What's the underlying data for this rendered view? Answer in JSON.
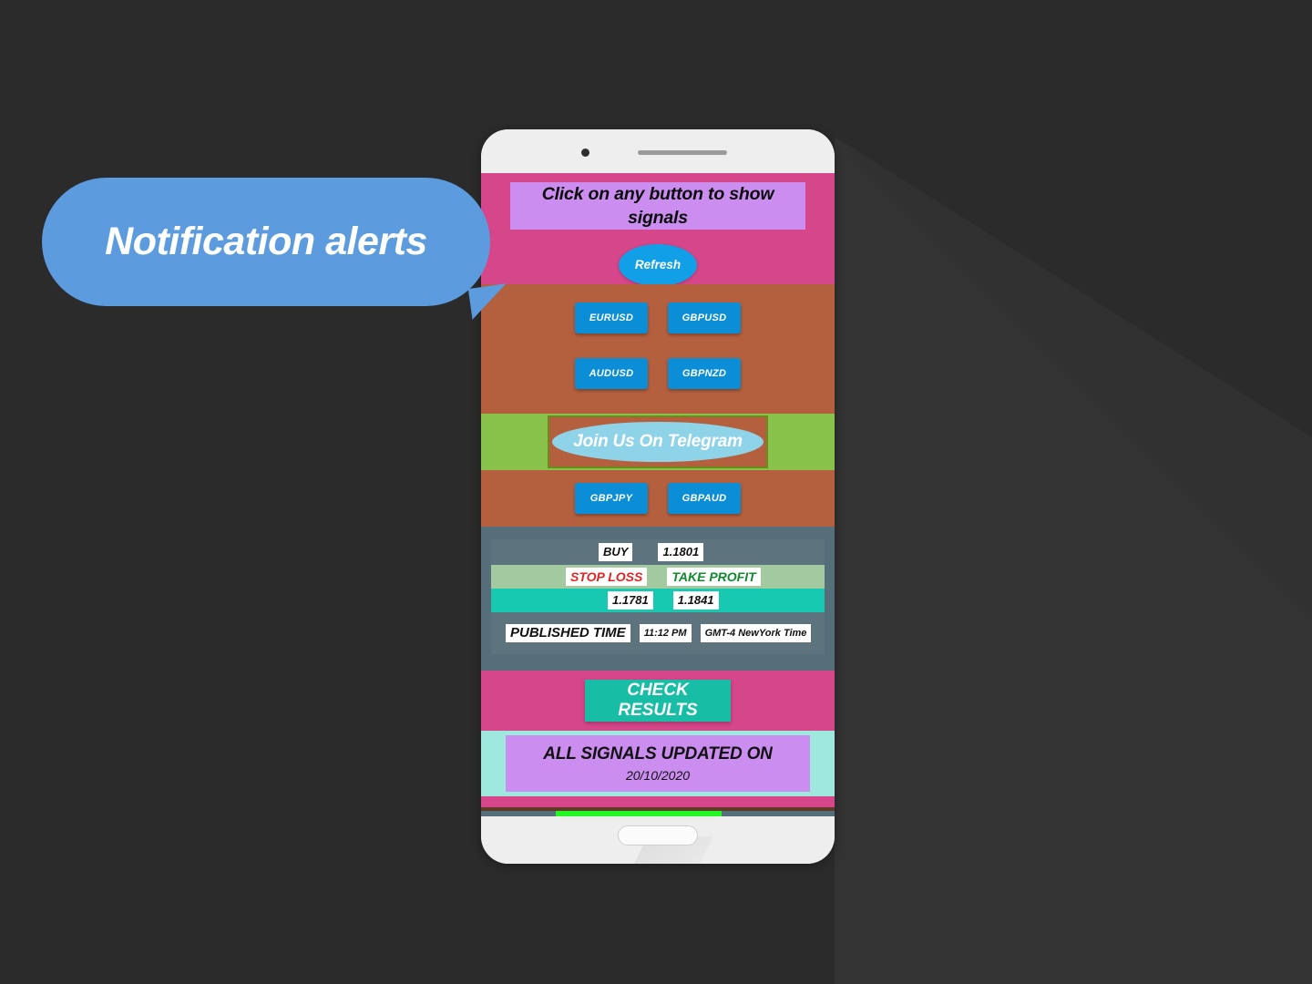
{
  "callout": {
    "text": "Notification alerts",
    "color": "#5b9bde"
  },
  "phone": {
    "hardware": {
      "camera": "camera-dot",
      "speaker": "speaker-grille",
      "home": "home-button"
    }
  },
  "screen": {
    "header": {
      "title": "Click on any button to show signals",
      "title_bg": "#cb8ef0",
      "band_bg": "#d6468a",
      "refresh_label": "Refresh",
      "refresh_bg": "#11a0e8"
    },
    "pairs_band_bg": "#b4603e",
    "pair_buttons_row1": [
      "EURUSD",
      "GBPUSD"
    ],
    "pair_buttons_row2": [
      "AUDUSD",
      "GBPNZD"
    ],
    "pair_buttons_row3": [
      "GBPJPY",
      "GBPAUD"
    ],
    "pair_button_bg": "#0c8ed7",
    "telegram": {
      "label": "Join Us On Telegram",
      "band_bg": "#89c24a",
      "button_bg": "#8ed3e8",
      "box_border": "#6c8b1f"
    },
    "signal": {
      "panel_bg": "#566e7a",
      "direction": "BUY",
      "entry_price": "1.1801",
      "stop_loss_label": "STOP LOSS",
      "stop_loss_color": "#e02424",
      "take_profit_label": "TAKE PROFIT",
      "take_profit_color": "#108a2e",
      "stop_loss_value": "1.1781",
      "take_profit_value": "1.1841",
      "labels_row_bg": "#a3c9a0",
      "values_row_bg": "#16c9b0",
      "published_time_label": "PUBLISHED TIME",
      "published_time": "11:12 PM",
      "timezone": "GMT-4 NewYork Time"
    },
    "results": {
      "label": "CHECK RESULTS",
      "band_bg": "#d6468a",
      "button_bg": "#17bda4"
    },
    "updated": {
      "title": "ALL SIGNALS UPDATED ON",
      "date": "20/10/2020",
      "band_bg": "#9fe8dd",
      "box_bg": "#cb8ef0"
    },
    "bottom_strip": {
      "pink": "#d6468a",
      "brown": "#5e3a27",
      "green_cut": "#25f425"
    }
  },
  "background": {
    "page_bg": "#2b2b2b",
    "shadow": "#333333"
  }
}
